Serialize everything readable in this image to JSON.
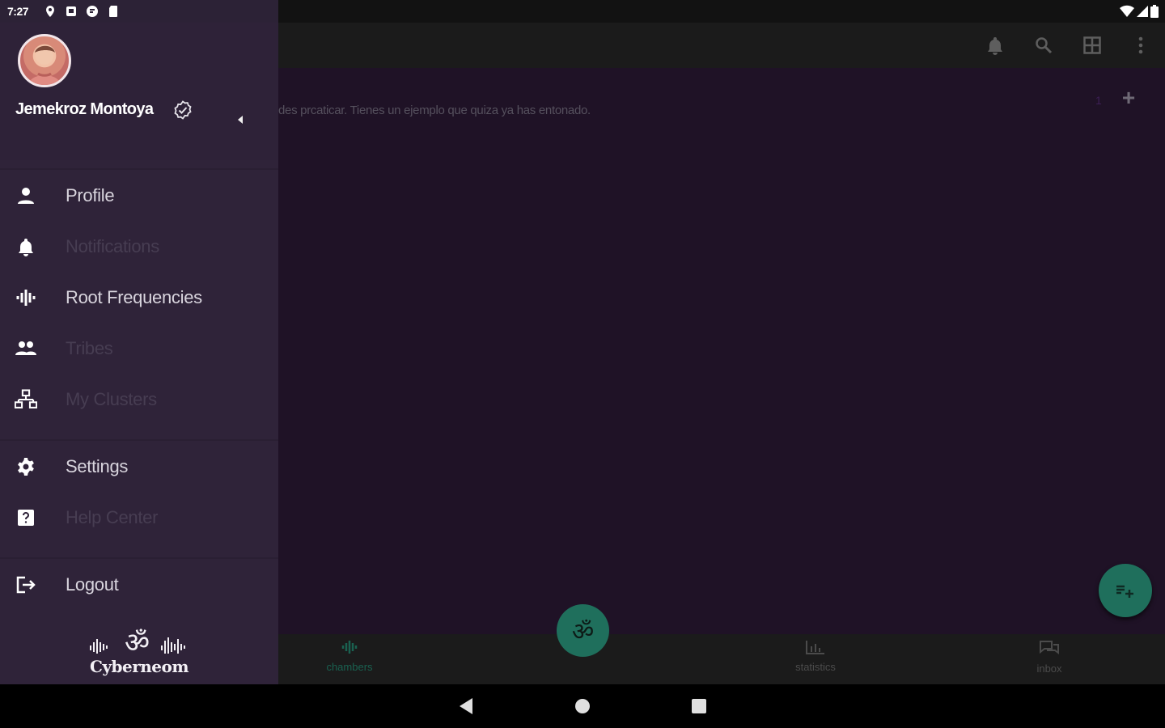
{
  "status_bar": {
    "time": "7:27",
    "left_icons": [
      "location-icon",
      "notification-square-icon",
      "notification-round-icon",
      "sd-card-icon"
    ],
    "right_icons": [
      "wifi-icon",
      "signal-icon",
      "battery-icon"
    ]
  },
  "app_bar": {
    "icons": [
      "bell-icon",
      "search-icon",
      "grid-icon",
      "more-vert-icon"
    ]
  },
  "content": {
    "hint_text": "des prcaticar. Tienes un ejemplo que quiza ya has entonado.",
    "count": "1",
    "add_symbol": "+"
  },
  "bottom_nav": {
    "items": [
      {
        "label": "chambers",
        "icon": "waveform-icon",
        "active": true
      },
      {
        "label": "statistics",
        "icon": "bar-chart-icon",
        "active": false
      },
      {
        "label": "inbox",
        "icon": "chat-icon",
        "active": false
      }
    ],
    "center_fab_symbol": "ॐ"
  },
  "drawer": {
    "user_name": "Jemekroz Montoya",
    "verified": true,
    "menu": [
      {
        "label": "Profile",
        "icon": "person-icon",
        "enabled": true
      },
      {
        "label": "Notifications",
        "icon": "bell-icon",
        "enabled": false
      },
      {
        "label": "Root Frequencies",
        "icon": "waveform-icon",
        "enabled": true
      },
      {
        "label": "Tribes",
        "icon": "group-icon",
        "enabled": false
      },
      {
        "label": "My Clusters",
        "icon": "network-icon",
        "enabled": false
      },
      {
        "label": "Settings",
        "icon": "gear-icon",
        "enabled": true
      },
      {
        "label": "Help Center",
        "icon": "help-icon",
        "enabled": false
      },
      {
        "label": "Logout",
        "icon": "logout-icon",
        "enabled": true
      }
    ],
    "logo_text": "Cyberneom"
  },
  "colors": {
    "drawer_bg": "#2f2339",
    "content_bg": "#1f1226",
    "accent_green": "#1f6f5c",
    "appbar_bg": "#1b1b1b"
  }
}
